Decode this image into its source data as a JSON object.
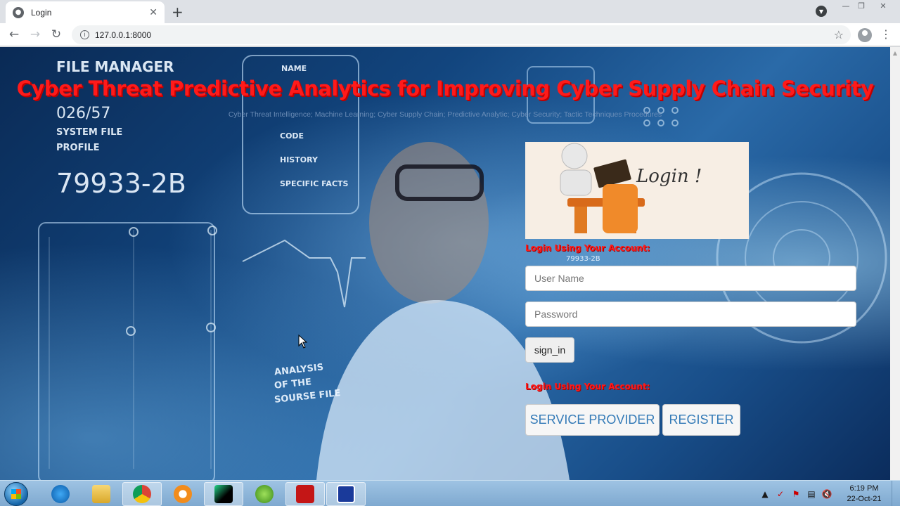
{
  "browser": {
    "tab_title": "Login",
    "url": "127.0.0.1:8000",
    "icons": [
      "back-icon",
      "forward-icon",
      "reload-icon",
      "info-icon",
      "star-icon",
      "profile-icon",
      "menu-icon",
      "close-icon",
      "new-tab-icon"
    ]
  },
  "page": {
    "title": "Cyber Threat Predictive Analytics for Improving Cyber Supply Chain Security",
    "subtitle": "Cyber Threat Intelligence; Machine Learning; Cyber Supply Chain; Predictive Analytic; Cyber Security; Tactic Techniques Procedures",
    "login_image_text": "Login !",
    "login_label_1": "Login Using Your Account:",
    "username_placeholder": "User Name",
    "password_placeholder": "Password",
    "sign_in_label": "sign_in",
    "login_label_2": "Login Using Your Account:",
    "service_provider_label": "SERVICE PROVIDER",
    "register_label": "REGISTER"
  },
  "background_hud": {
    "file_manager": "FILE MANAGER",
    "count": "026/57",
    "system_file": "SYSTEM FILE",
    "profile": "PROFILE",
    "code": "79933-2B",
    "name_label": "NAME",
    "code_label": "CODE",
    "history_label": "HISTORY",
    "specific_facts": "SPECIFIC FACTS",
    "analysis": "ANALYSIS",
    "of_the": "OF THE",
    "source_file": "SOURSE FILE",
    "code_small": "79933-2B"
  },
  "taskbar": {
    "apps": [
      "ie-icon",
      "explorer-icon",
      "chrome-icon",
      "app-icon",
      "pycharm-icon",
      "app-icon",
      "acrobat-icon",
      "app-icon"
    ],
    "time": "6:19 PM",
    "date": "22-Oct-21"
  },
  "colors": {
    "title_red": "#ff1a1a",
    "link_blue": "#337ab7",
    "taskbar": "#9ec3e3"
  }
}
